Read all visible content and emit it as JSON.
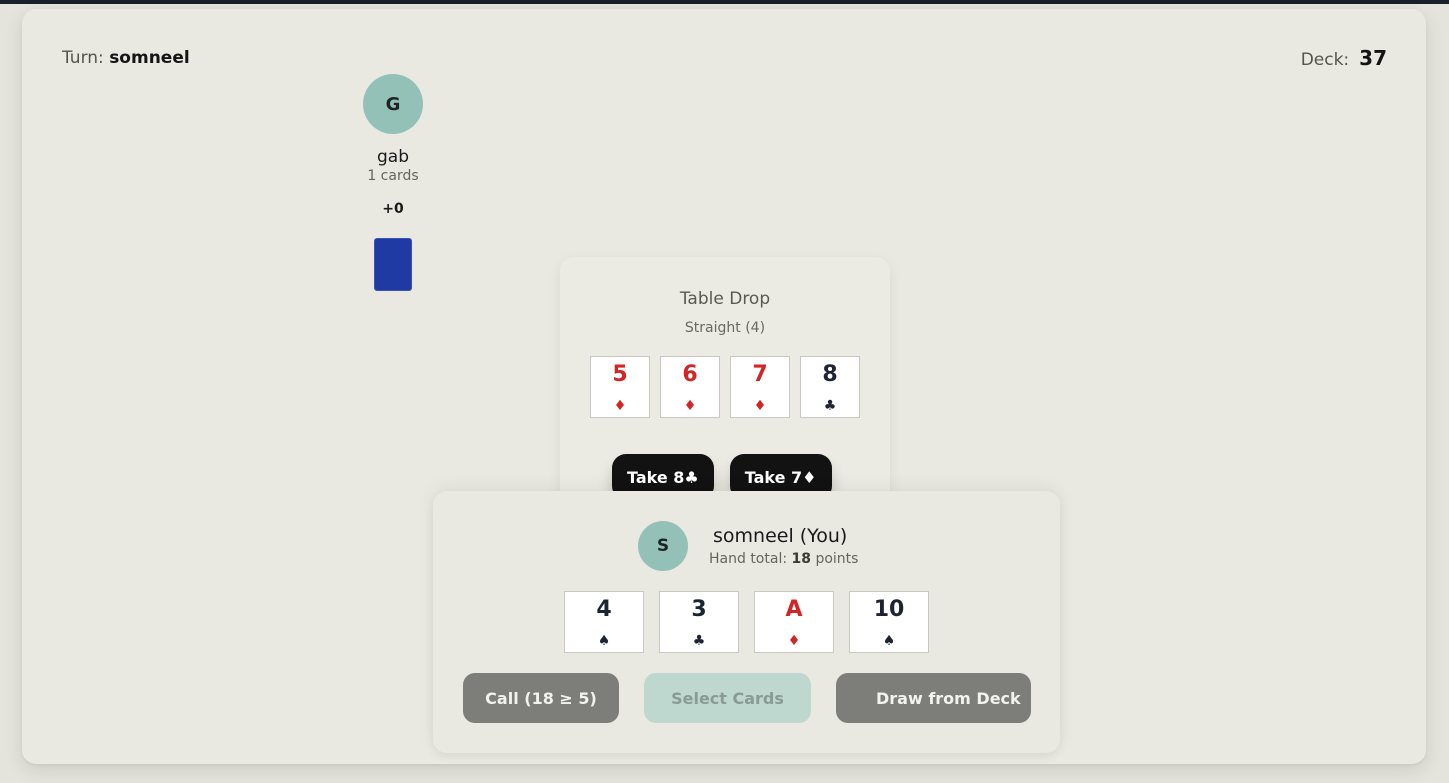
{
  "header": {
    "turn_label": "Turn:",
    "turn_player": "somneel",
    "deck_label": "Deck:",
    "deck_count": "37"
  },
  "opponent": {
    "initial": "G",
    "name": "gab",
    "cards": "1 cards",
    "score": "+0"
  },
  "table_drop": {
    "title": "Table Drop",
    "subtitle": "Straight (4)",
    "cards": [
      {
        "rank": "5",
        "suit": "♦",
        "color": "red"
      },
      {
        "rank": "6",
        "suit": "♦",
        "color": "red"
      },
      {
        "rank": "7",
        "suit": "♦",
        "color": "red"
      },
      {
        "rank": "8",
        "suit": "♣",
        "color": "black"
      }
    ],
    "take_buttons": [
      "Take 8♣",
      "Take 7♦"
    ]
  },
  "player": {
    "initial": "S",
    "name": "somneel (You)",
    "hand_total_label": "Hand total:",
    "hand_total_value": "18",
    "hand_total_unit": "points",
    "cards": [
      {
        "rank": "4",
        "suit": "♠",
        "color": "black"
      },
      {
        "rank": "3",
        "suit": "♣",
        "color": "black"
      },
      {
        "rank": "A",
        "suit": "♦",
        "color": "red"
      },
      {
        "rank": "10",
        "suit": "♠",
        "color": "black"
      }
    ]
  },
  "actions": {
    "call": "Call (18 ≥ 5)",
    "select": "Select Cards",
    "draw": "Draw from Deck"
  },
  "colors": {
    "red_suit": "#d42525",
    "black_suit": "#1c2332",
    "avatar": "#93c1b8",
    "card_back": "#1f3aa3"
  }
}
